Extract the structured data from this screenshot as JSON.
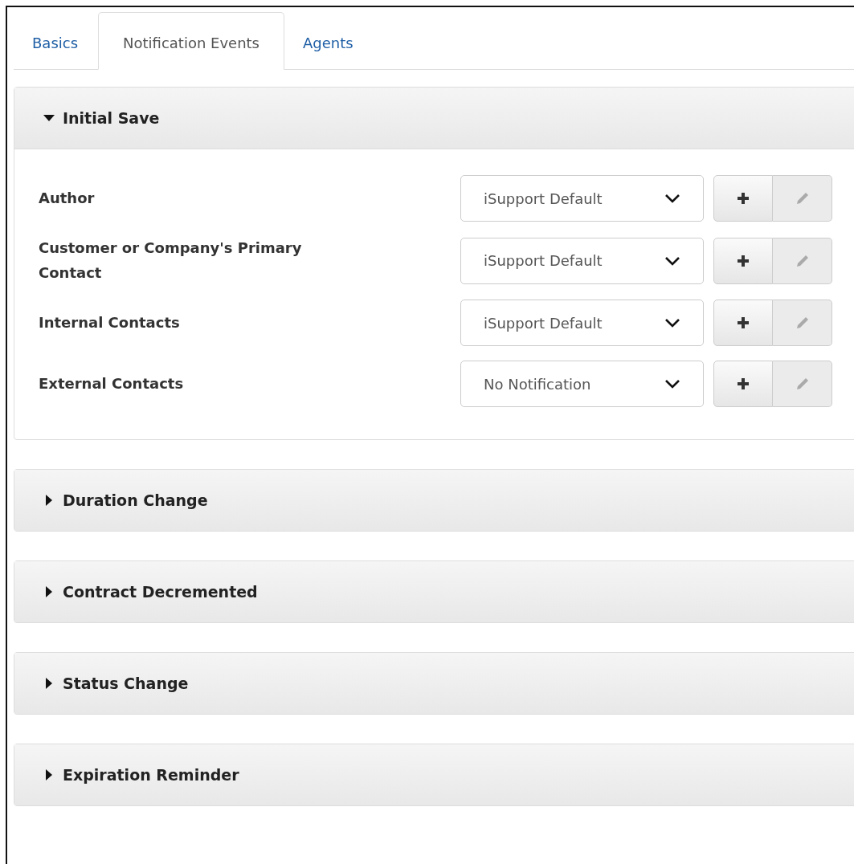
{
  "tabs": [
    {
      "label": "Basics",
      "selected": false
    },
    {
      "label": "Notification Events",
      "selected": true
    },
    {
      "label": "Agents",
      "selected": false
    }
  ],
  "sections": [
    {
      "title": "Initial Save",
      "expanded": true,
      "rows": [
        {
          "label": "Author",
          "value": "iSupport Default",
          "edit_disabled": true
        },
        {
          "label": "Customer or Company's Primary Contact",
          "value": "iSupport Default",
          "edit_disabled": true
        },
        {
          "label": "Internal Contacts",
          "value": "iSupport Default",
          "edit_disabled": true
        },
        {
          "label": "External Contacts",
          "value": "No Notification",
          "edit_disabled": true
        }
      ]
    },
    {
      "title": "Duration Change",
      "expanded": false
    },
    {
      "title": "Contract Decremented",
      "expanded": false
    },
    {
      "title": "Status Change",
      "expanded": false
    },
    {
      "title": "Expiration Reminder",
      "expanded": false
    }
  ]
}
